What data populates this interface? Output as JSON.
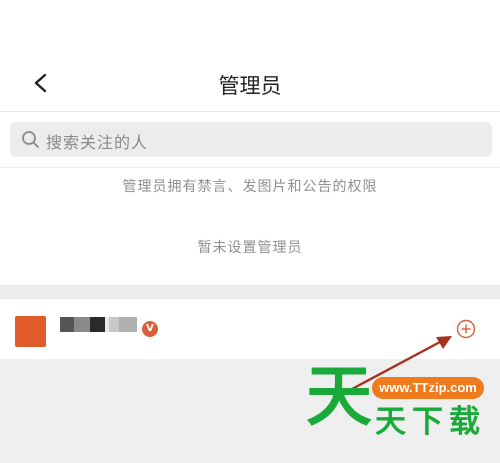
{
  "header": {
    "title": "管理员",
    "back_icon": "chevron-left-icon"
  },
  "search": {
    "placeholder": "搜索关注的人",
    "icon": "search-icon"
  },
  "info_text": "管理员拥有禁言、发图片和公告的权限",
  "empty_state": "暂未设置管理员",
  "user_row": {
    "name": "",
    "verified_badge": "V",
    "action_icon": "plus-circle-icon"
  },
  "colors": {
    "accent": "#e05a2a",
    "text_secondary": "#8f8f8f",
    "watermark_green": "#1aaa3a",
    "watermark_orange": "#f07a1e"
  },
  "watermark": {
    "big_char": "天",
    "url": "www.TTzip.com",
    "text": "天下载"
  }
}
